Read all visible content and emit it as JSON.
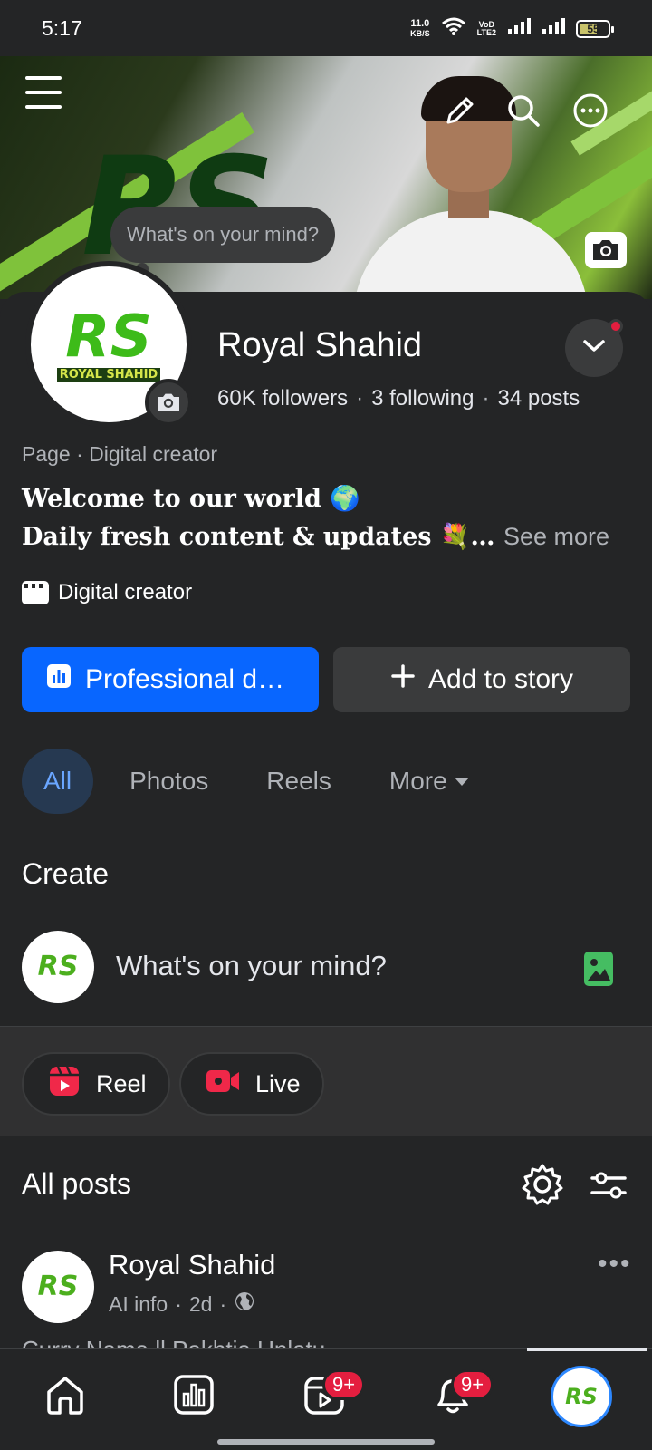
{
  "status_bar": {
    "time": "5:17",
    "net_speed_value": "11.0",
    "net_speed_unit": "KB/S",
    "volte_line1": "VoD",
    "volte_line2": "LTE2",
    "battery": "55"
  },
  "cover": {
    "logo_text": "RS",
    "mind_bubble": "What's on your mind?"
  },
  "profile": {
    "name": "Royal Shahid",
    "followers": "60K followers",
    "following": "3 following",
    "posts": "34 posts",
    "separator": "·",
    "avatar_logo": "RS",
    "avatar_logo_sub": "ROYAL SHAHID",
    "page_category": "Page · Digital creator",
    "bio_line1": "Welcome to our world 🌍",
    "bio_line2": "Daily fresh content & updates 💐…",
    "see_more": "See more",
    "creator_label": "Digital creator"
  },
  "actions": {
    "primary_label": "Professional d…",
    "secondary_label": "Add to story"
  },
  "tabs": [
    {
      "label": "All"
    },
    {
      "label": "Photos"
    },
    {
      "label": "Reels"
    },
    {
      "label": "More"
    }
  ],
  "create": {
    "heading": "Create",
    "placeholder": "What's on your mind?",
    "reel_label": "Reel",
    "live_label": "Live"
  },
  "posts": {
    "heading": "All posts",
    "items": [
      {
        "author": "Royal Shahid",
        "meta_source": "AI info",
        "meta_time": "2d",
        "meta_sep": "·",
        "more": "•••",
        "snippet": "Curry Nama ll Pakhtia Unlatu"
      }
    ]
  },
  "bottom_nav": {
    "video_badge": "9+",
    "notifications_badge": "9+"
  },
  "colors": {
    "background": "#242526",
    "primary": "#0866ff",
    "badge": "#e41e3f",
    "tab_active_bg": "#263951",
    "tab_active_text": "#6aa6ff"
  },
  "icons": [
    "menu-icon",
    "edit-icon",
    "search-icon",
    "more-icon",
    "camera-icon",
    "chevron-down-icon",
    "clapperboard-icon",
    "insights-icon",
    "plus-icon",
    "photo-icon",
    "reel-icon",
    "live-icon",
    "gear-icon",
    "filter-icon",
    "globe-icon",
    "home-icon",
    "dashboard-icon",
    "video-icon",
    "bell-icon"
  ]
}
